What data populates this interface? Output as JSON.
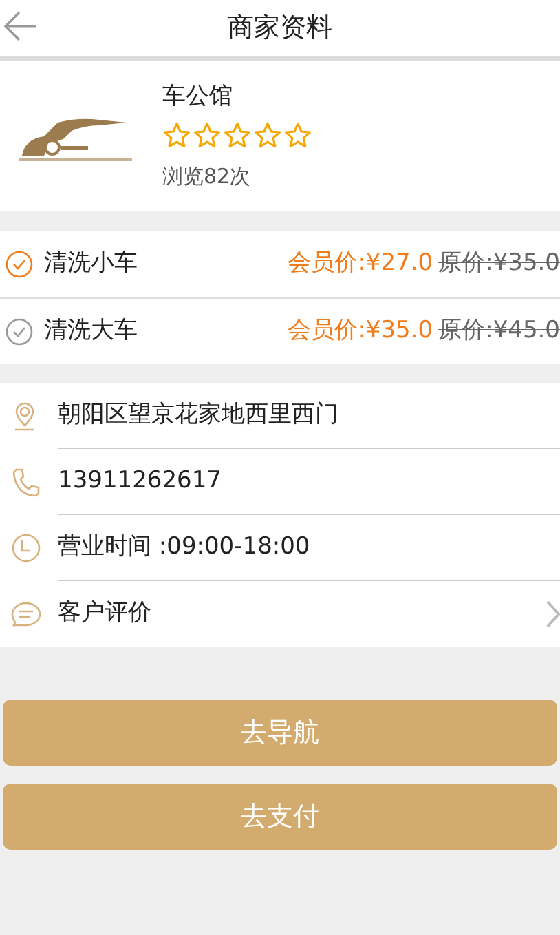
{
  "header": {
    "title": "商家资料"
  },
  "shop": {
    "name": "车公馆",
    "stars": 0,
    "views": "浏览82次"
  },
  "services": [
    {
      "name": "清洗小车",
      "selected": true,
      "member_price": "会员价:¥27.0",
      "original_price": "原价:¥35.0"
    },
    {
      "name": "清洗大车",
      "selected": false,
      "member_price": "会员价:¥35.0",
      "original_price": "原价:¥45.0"
    }
  ],
  "info": [
    {
      "kind": "location",
      "text": "朝阳区望京花家地西里西门"
    },
    {
      "kind": "phone",
      "text": "13911262617"
    },
    {
      "kind": "clock",
      "text": "营业时间 :09:00-18:00"
    },
    {
      "kind": "comment",
      "text": "客户评价",
      "link": true
    }
  ],
  "buttons": [
    "去导航",
    "去支付"
  ]
}
